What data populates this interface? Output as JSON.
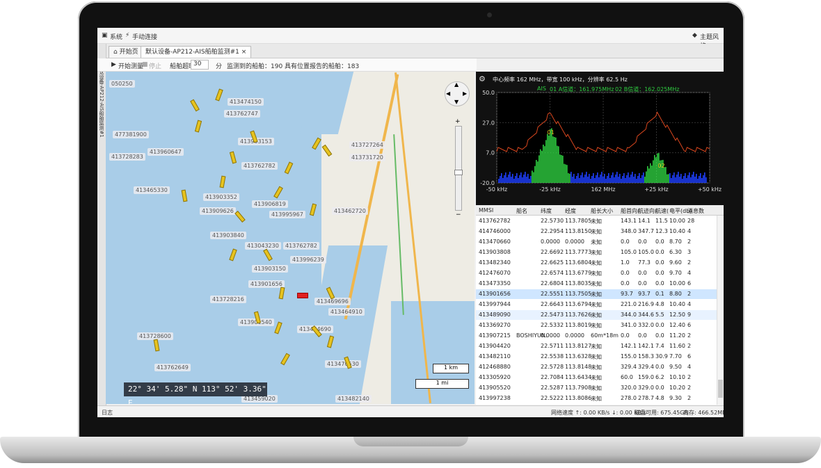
{
  "menubar": {
    "system": "系统",
    "manual_connect": "手动连接",
    "theme": "主题风格"
  },
  "tabs": [
    {
      "label": "开始页"
    },
    {
      "label": "默认设备-AP212-AIS船舶监测#1",
      "close": "×"
    }
  ],
  "sidebar": {
    "label": "默认设备-AP212-AIS船舶监测#1"
  },
  "toolbar": {
    "start": "开始测量",
    "stop": "停止",
    "interval_label": "船舶超时:",
    "interval_value": "30",
    "unit": "分",
    "summary": "监测到的船舶：190 具有位置报告的船舶：183"
  },
  "map": {
    "coords": {
      "deg1": "22°",
      "min1": "34'",
      "sec1": "5.28\"",
      "dir1": "N",
      "deg2": "113°",
      "min2": "52'",
      "sec2": "3.36\"",
      "dir2": "E"
    },
    "scale_km": "1 km",
    "scale_mi": "1 mi",
    "labels": [
      "050250",
      "413474150",
      "413762747",
      "477381900",
      "413903153",
      "413727264",
      "413960647",
      "413762782",
      "413728283",
      "413465330",
      "413731720",
      "413903352",
      "413906819",
      "413909626",
      "413995967",
      "413462720",
      "413043230",
      "413762782",
      "413996239",
      "413903840",
      "413903150",
      "413901656",
      "413728216",
      "413469696",
      "413901540",
      "413464910",
      "413464690",
      "413728600",
      "413470530",
      "413762649",
      "413459020",
      "413482140"
    ]
  },
  "spectrum": {
    "header": "中心频率 162 MHz，带宽 100 kHz，分辨率 62.5 Hz",
    "legend_ais": "AIS",
    "legend_a": "01 A信道：161.975MHz",
    "legend_b": "02 B信道：162.025MHz",
    "yticks": [
      "50.0",
      "27.0",
      "7.0",
      "-20.0"
    ],
    "xticks": [
      "-50 kHz",
      "-25 kHz",
      "162 MHz",
      "+25 kHz",
      "+50 kHz"
    ],
    "marker1": "01",
    "marker2": "02"
  },
  "table": {
    "headers": [
      "MMSI",
      "船名",
      "纬度",
      "经度",
      "船长大小",
      "船首向(",
      "航迹向(",
      "航速(",
      "电平(db)",
      "消息数"
    ],
    "rows": [
      [
        "413762782",
        "",
        "22.5730",
        "113.7805",
        "未知",
        "143.1",
        "14.1",
        "11.5",
        "10.00",
        "28"
      ],
      [
        "414746000",
        "",
        "22.2954",
        "113.8150",
        "未知",
        "348.0",
        "347.7",
        "12.3",
        "10.40",
        "4"
      ],
      [
        "413470660",
        "",
        "0.0000",
        "0.0000",
        "未知",
        "0.0",
        "0.0",
        "0.0",
        "8.70",
        "2"
      ],
      [
        "413903808",
        "",
        "22.6692",
        "113.7773",
        "未知",
        "105.0",
        "105.0",
        "0.0",
        "6.30",
        "3"
      ],
      [
        "413482340",
        "",
        "22.6625",
        "113.6804",
        "未知",
        "1.0",
        "77.3",
        "0.0",
        "9.60",
        "2"
      ],
      [
        "412476070",
        "",
        "22.6574",
        "113.6779",
        "未知",
        "0.0",
        "0.0",
        "0.0",
        "9.70",
        "4"
      ],
      [
        "413473350",
        "",
        "22.6804",
        "113.8035",
        "未知",
        "0.0",
        "0.0",
        "0.0",
        "10.00",
        "6"
      ],
      [
        "413901656",
        "",
        "22.5551",
        "113.7505",
        "未知",
        "93.7",
        "93.7",
        "0.1",
        "8.80",
        "2"
      ],
      [
        "413997944",
        "",
        "22.6643",
        "113.6794",
        "未知",
        "221.0",
        "216.9",
        "4.8",
        "10.40",
        "4"
      ],
      [
        "413489090",
        "",
        "22.5473",
        "113.7626",
        "未知",
        "344.0",
        "344.6",
        "5.5",
        "12.50",
        "9"
      ],
      [
        "413369270",
        "",
        "22.5332",
        "113.8019",
        "未知",
        "341.0",
        "332.0",
        "0.0",
        "12.40",
        "6"
      ],
      [
        "413907215",
        "BOSHIYUN.",
        "0.0000",
        "0.0000",
        "60m*18m",
        "0.0",
        "0.0",
        "0.0",
        "11.20",
        "2"
      ],
      [
        "413904420",
        "",
        "22.5711",
        "113.8127",
        "未知",
        "142.1",
        "142.1",
        "7.4",
        "11.60",
        "2"
      ],
      [
        "413482110",
        "",
        "22.5538",
        "113.6328",
        "未知",
        "155.0",
        "158.3",
        "30.9",
        "7.70",
        "6"
      ],
      [
        "412468880",
        "",
        "22.5728",
        "113.8148",
        "未知",
        "329.4",
        "329.4",
        "0.0",
        "9.50",
        "4"
      ],
      [
        "413305920",
        "",
        "22.7084",
        "113.6434",
        "未知",
        "60.0",
        "159.0",
        "6.2",
        "10.10",
        "2"
      ],
      [
        "413905520",
        "",
        "22.5287",
        "113.7908",
        "未知",
        "320.0",
        "329.0",
        "0.0",
        "10.20",
        "2"
      ],
      [
        "413997238",
        "",
        "22.5222",
        "113.8086",
        "未知",
        "278.0",
        "278.7",
        "4.8",
        "9.30",
        "2"
      ]
    ]
  },
  "status": {
    "left": "日志",
    "network": "网络速度 ↑: 0.00 KB/s ↓: 0.00 KB/s",
    "disk": "磁盘可用: 675.45GB",
    "memory": "内存: 466.52MB"
  },
  "colors": {
    "sea": "#a9cde8",
    "land": "#eeece4",
    "ship": "#e7c31e",
    "selected_ship": "#e02020",
    "spectrum_line": "#d8461e",
    "spectrum_bar_green": "#2ecc40",
    "spectrum_bar_blue": "#1f3fff",
    "selected_row": "#cfe6ff"
  }
}
